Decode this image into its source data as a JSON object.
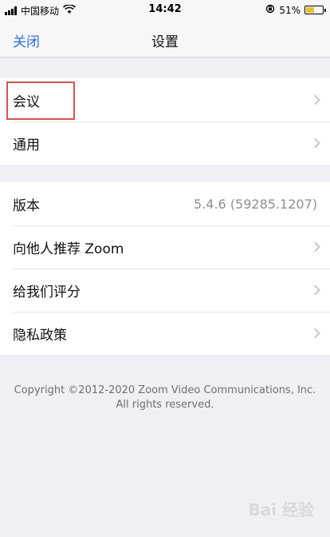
{
  "status_bar": {
    "carrier": "中国移动",
    "time": "14:42",
    "battery": "51%",
    "battery_level": 0.51
  },
  "nav": {
    "close_label": "关闭",
    "title": "设置"
  },
  "group1": {
    "items": [
      {
        "label": "会议"
      },
      {
        "label": "通用"
      }
    ]
  },
  "group2": {
    "version_label": "版本",
    "version_value": "5.4.6 (59285.1207)",
    "items": [
      {
        "label": "向他人推荐 Zoom"
      },
      {
        "label": "给我们评分"
      },
      {
        "label": "隐私政策"
      }
    ]
  },
  "footer": {
    "line1": "Copyright ©2012-2020 Zoom Video Communications, Inc.",
    "line2": "All rights reserved."
  },
  "watermark": {
    "text": "Bai 经验"
  },
  "colors": {
    "accent": "#2f6fe0",
    "highlight": "#d9534f"
  }
}
